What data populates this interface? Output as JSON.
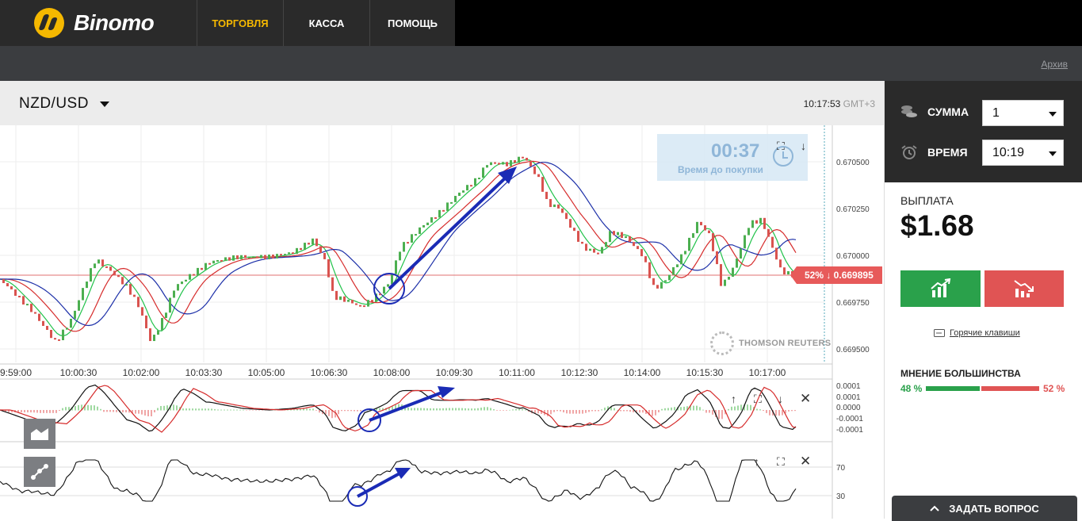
{
  "header": {
    "logo_text": "Binomo",
    "nav": [
      {
        "label": "ТОРГОВЛЯ",
        "active": true
      },
      {
        "label": "КАССА",
        "active": false
      },
      {
        "label": "ПОМОЩЬ",
        "active": false
      }
    ]
  },
  "subbar": {
    "archive_link": "Архив"
  },
  "chart": {
    "pair": "NZD/USD",
    "time": "10:17:53",
    "timezone": "GMT+3",
    "timer_value": "00:37",
    "timer_label": "Время до покупки",
    "price_tag": "52% ↓  0.669895",
    "watermark": "THOMSON REUTERS",
    "price_axis": [
      "0.670500",
      "0.670250",
      "0.670000",
      "0.669750",
      "0.669500"
    ],
    "time_axis": [
      "9:59:00",
      "10:00:30",
      "10:02:00",
      "10:03:30",
      "10:05:00",
      "10:06:30",
      "10:08:00",
      "10:09:30",
      "10:11:00",
      "10:12:30",
      "10:14:00",
      "10:15:30",
      "10:17:00"
    ],
    "macd_axis": [
      "0.0001",
      "0.0001",
      "0.0000",
      "-0.0001",
      "-0.0001"
    ],
    "rsi_axis": [
      "70",
      "30"
    ]
  },
  "right_panel": {
    "amount_label": "СУММА",
    "amount_value": "1",
    "time_label": "ВРЕМЯ",
    "time_value": "10:19",
    "payout_label": "ВЫПЛАТА",
    "payout_value": "$1.68",
    "hotkeys_label": "Горячие клавиши",
    "majority_label": "МНЕНИЕ БОЛЬШИНСТВА",
    "majority_up": "48 %",
    "majority_down": "52 %",
    "majority_up_fraction": 0.48,
    "ask_button": "ЗАДАТЬ ВОПРОС"
  },
  "colors": {
    "accent": "#f5b800",
    "up": "#2aa14b",
    "down": "#e05454",
    "timer": "#8fb6d8"
  }
}
